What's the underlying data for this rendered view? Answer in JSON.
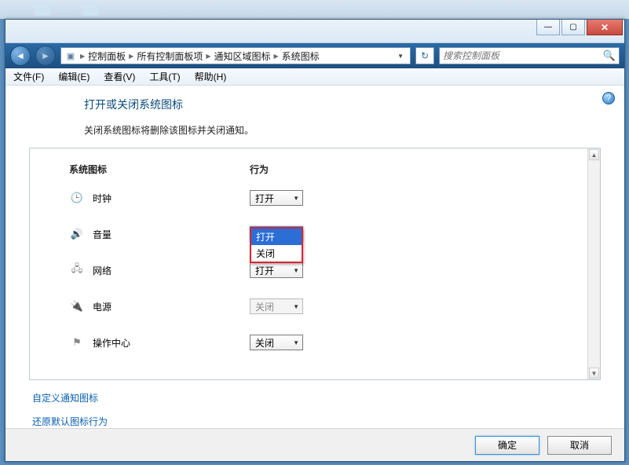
{
  "breadcrumbs": [
    "控制面板",
    "所有控制面板项",
    "通知区域图标",
    "系统图标"
  ],
  "search": {
    "placeholder": "搜索控制面板"
  },
  "menu": {
    "file": "文件(F)",
    "edit": "编辑(E)",
    "view": "查看(V)",
    "tools": "工具(T)",
    "help": "帮助(H)"
  },
  "page": {
    "heading": "打开或关闭系统图标",
    "subtext": "关闭系统图标将删除该图标并关闭通知。",
    "col_icon": "系统图标",
    "col_behavior": "行为"
  },
  "rows": {
    "clock": {
      "label": "时钟",
      "value": "打开"
    },
    "volume": {
      "label": "音量",
      "value": "打开"
    },
    "network": {
      "label": "网络",
      "value": "打开"
    },
    "power": {
      "label": "电源",
      "value": "关闭"
    },
    "action": {
      "label": "操作中心",
      "value": "关闭"
    }
  },
  "dropdown": {
    "opt_open": "打开",
    "opt_close": "关闭"
  },
  "links": {
    "customize": "自定义通知图标",
    "restore": "还原默认图标行为"
  },
  "buttons": {
    "ok": "确定",
    "cancel": "取消"
  }
}
